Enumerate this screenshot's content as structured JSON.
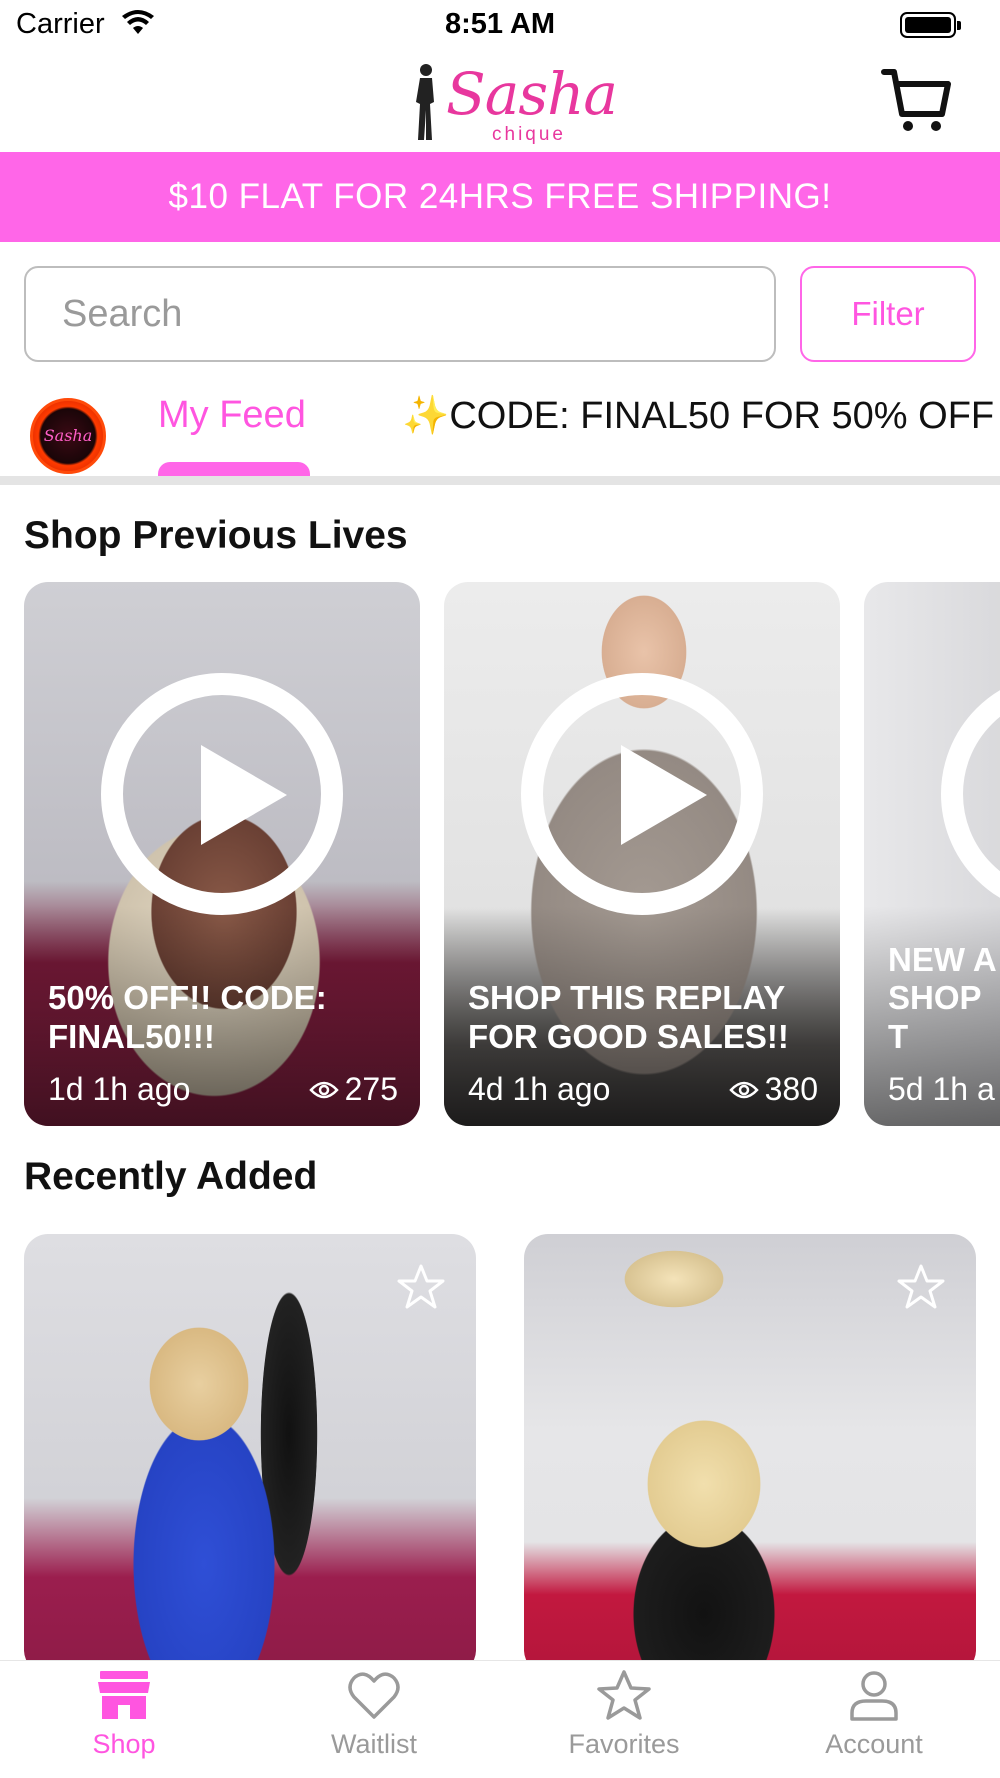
{
  "status_bar": {
    "carrier": "Carrier",
    "time": "8:51 AM"
  },
  "header": {
    "logo_text": "Sasha",
    "logo_subtext": "chique",
    "cart_icon": "cart-icon"
  },
  "promo_banner": {
    "text": "$10 FLAT FOR 24HRS FREE SHIPPING!",
    "color": "#ff66e8"
  },
  "search": {
    "placeholder": "Search",
    "value": ""
  },
  "filter": {
    "label": "Filter"
  },
  "feed_tabs": {
    "avatar_text": "Sasha",
    "items": [
      {
        "label": "My Feed",
        "active": true
      },
      {
        "label": "CODE: FINAL50 FOR 50% OFF",
        "prefix": "✨",
        "active": false
      }
    ]
  },
  "previous_lives": {
    "title": "Shop Previous Lives",
    "cards": [
      {
        "title": "50% OFF!! CODE: FINAL50!!!",
        "time": "1d 1h ago",
        "views": "275"
      },
      {
        "title": "SHOP THIS REPLAY FOR GOOD SALES!!",
        "time": "4d 1h ago",
        "views": "380"
      },
      {
        "title": "NEW A SHOP T",
        "time": "5d 1h a",
        "views": ""
      }
    ]
  },
  "recently_added": {
    "title": "Recently Added",
    "products": [
      {
        "favorite_icon": "star-icon",
        "favorited": false
      },
      {
        "favorite_icon": "star-icon",
        "favorited": false
      }
    ]
  },
  "tab_bar": {
    "items": [
      {
        "label": "Shop",
        "icon": "storefront-icon",
        "active": true
      },
      {
        "label": "Waitlist",
        "icon": "heart-icon",
        "active": false
      },
      {
        "label": "Favorites",
        "icon": "star-icon",
        "active": false
      },
      {
        "label": "Account",
        "icon": "person-icon",
        "active": false
      }
    ]
  },
  "colors": {
    "accent": "#ff55e0",
    "banner": "#ff66e8",
    "inactive": "#9a9a9a"
  }
}
